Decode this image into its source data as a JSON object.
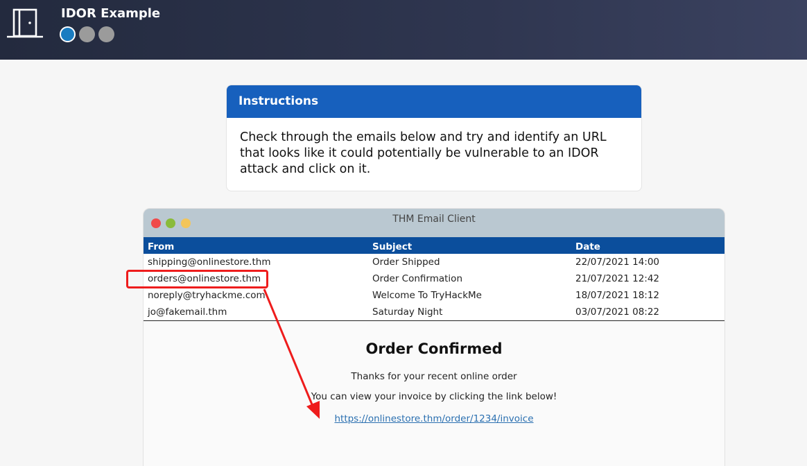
{
  "app": {
    "title": "IDOR Example",
    "steps": [
      {
        "state": "active"
      },
      {
        "state": "inactive"
      },
      {
        "state": "inactive"
      }
    ]
  },
  "instructions": {
    "heading": "Instructions",
    "body": "Check through the emails below and try and identify an URL that looks like it could potentially be vulnerable to an IDOR attack and click on it."
  },
  "email_client": {
    "title": "THM Email Client",
    "columns": [
      "From",
      "Subject",
      "Date"
    ],
    "emails": [
      {
        "from": "shipping@onlinestore.thm",
        "subject": "Order Shipped",
        "date": "22/07/2021 14:00"
      },
      {
        "from": "orders@onlinestore.thm",
        "subject": "Order Confirmation",
        "date": "21/07/2021 12:42"
      },
      {
        "from": "noreply@tryhackme.com",
        "subject": "Welcome To TryHackMe",
        "date": "18/07/2021 18:12"
      },
      {
        "from": "jo@fakemail.thm",
        "subject": "Saturday Night",
        "date": "03/07/2021 08:22"
      }
    ],
    "message": {
      "title": "Order Confirmed",
      "line1": "Thanks for your recent online order",
      "line2": "You can view your invoice by clicking the link below!",
      "link": "https://onlinestore.thm/order/1234/invoice"
    }
  },
  "colors": {
    "header_blue": "#1760bd",
    "table_header": "#0b4e9c",
    "annotation_red": "#ee1c1c",
    "link": "#2a6fb0"
  }
}
